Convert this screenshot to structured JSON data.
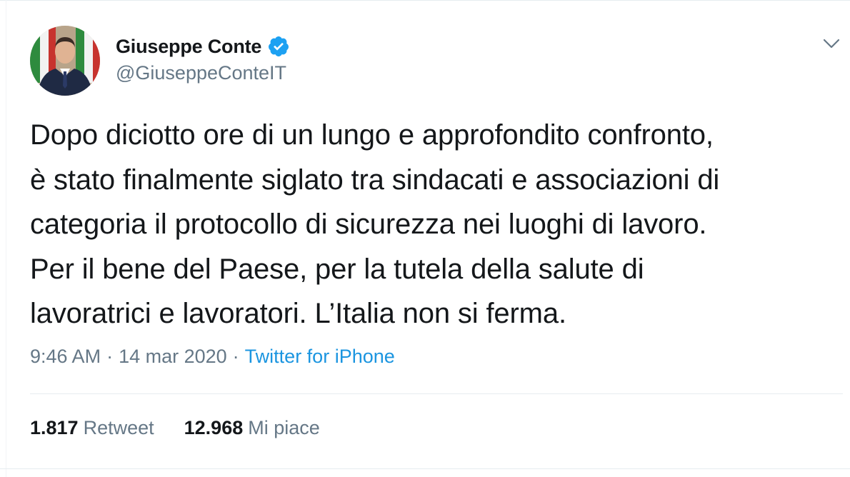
{
  "author": {
    "display_name": "Giuseppe Conte",
    "handle": "@GiuseppeConteIT",
    "verified": true
  },
  "tweet": {
    "lines": [
      "Dopo diciotto ore di un lungo e approfondito confronto,",
      "è stato finalmente siglato tra sindacati e associazioni di",
      "categoria il protocollo di sicurezza nei luoghi di lavoro.",
      "Per il bene del Paese, per la tutela della salute di",
      "lavoratrici e lavoratori. L’Italia non si ferma."
    ]
  },
  "meta": {
    "time": "9:46 AM",
    "separator": "·",
    "date": "14 mar 2020",
    "source": "Twitter for iPhone"
  },
  "stats": {
    "retweets_count": "1.817",
    "retweets_label": "Retweet",
    "likes_count": "12.968",
    "likes_label": "Mi piace"
  },
  "colors": {
    "text": "#14171a",
    "secondary": "#657786",
    "accent": "#1b95e0",
    "verified": "#1da1f2",
    "border": "#e6ecf0"
  },
  "icons": {
    "verified": "verified-badge-icon",
    "menu": "chevron-down-icon"
  }
}
